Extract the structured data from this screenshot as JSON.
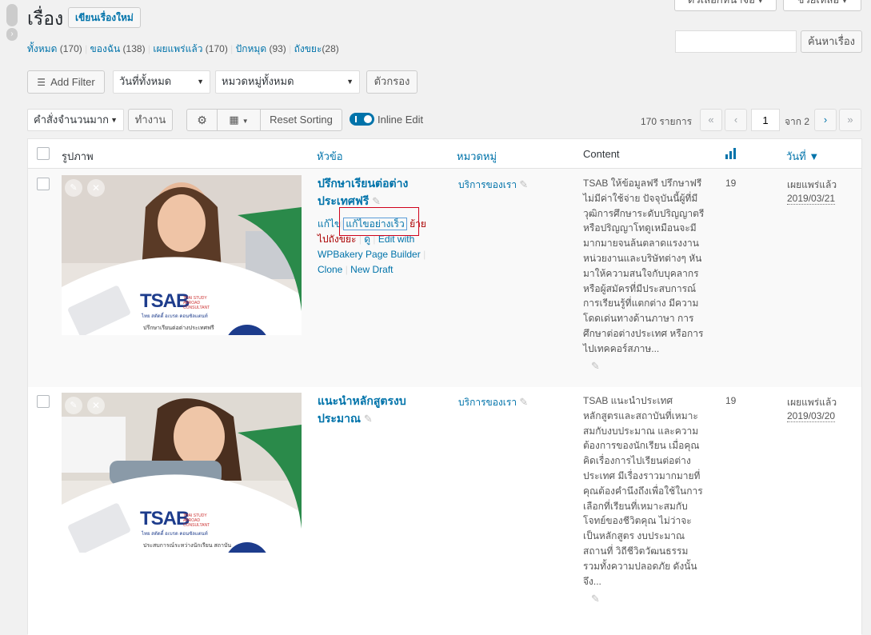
{
  "header": {
    "title": "เรื่อง",
    "add_new": "เขียนเรื่องใหม่",
    "screen_options": "ตัวเลือกหน้าจอ ▾",
    "help": "ช่วยเหลือ ▾"
  },
  "views": {
    "all": "ทั้งหมด",
    "all_count": "(170)",
    "mine": "ของฉัน",
    "mine_count": "(138)",
    "published": "เผยแพร่แล้ว",
    "published_count": "(170)",
    "sticky": "ปักหมุด",
    "sticky_count": "(93)",
    "trash": "ถังขยะ",
    "trash_count": "(28)"
  },
  "search": {
    "button": "ค้นหาเรื่อง",
    "value": ""
  },
  "filters": {
    "add_filter": "Add Filter",
    "date": "วันที่ทั้งหมด",
    "category": "หมวดหมู่ทั้งหมด",
    "filter_button": "ตัวกรอง"
  },
  "bulk": {
    "action": "คำสั่งจำนวนมาก",
    "apply": "ทำงาน",
    "reset_sorting": "Reset Sorting",
    "inline_edit": "Inline Edit"
  },
  "pagination": {
    "items": "170 รายการ",
    "first": "«",
    "prev": "‹",
    "current": "1",
    "of": "จาก 2",
    "next": "›",
    "last": "»"
  },
  "columns": {
    "image": "รูปภาพ",
    "title": "หัวข้อ",
    "category": "หมวดหมู่",
    "content": "Content",
    "date": "วันที่ ▼"
  },
  "rows": [
    {
      "title_line1": "ปรึกษาเรียนต่อต่าง",
      "title_line2": "ประเทศฟรี",
      "actions": {
        "edit": "แก้ไข",
        "quick_edit": "แก้ไขอย่างเร็ว",
        "trash_a": "ย้าย",
        "trash_b": "ไปถังขยะ",
        "view": "ดู",
        "wpbakery_a": "Edit with",
        "wpbakery_b": "WPBakery Page Builder",
        "clone": "Clone",
        "new_draft": "New Draft"
      },
      "category": "บริการของเรา",
      "content_lines": [
        "TSAB ให้ข้อมูลฟรี ปรึกษาฟรี",
        "ไม่มีค่าใช้จ่าย ปัจจุบันนี้ผู้ที่มี",
        "วุฒิการศึกษาระดับปริญญาตรี",
        "หรือปริญญาโทดูเหมือนจะมี",
        "มากมายจนล้นตลาดแรงงาน",
        "หน่วยงานและบริษัทต่างๆ หัน",
        "มาให้ความสนใจกับบุคลากร",
        "หรือผู้สมัครที่มีประสบการณ์",
        "การเรียนรู้ที่แตกต่าง มีความ",
        "โดดเด่นทางด้านภาษา การ",
        "ศึกษาต่อต่างประเทศ หรือการ",
        "ไปเทคคอร์สภาษ..."
      ],
      "views": "19",
      "status": "เผยแพร่แล้ว",
      "date": "2019/03/21",
      "thumb_line": "ปรึกษาเรียนต่อต่างประเทศฟรี"
    },
    {
      "title_line1": "แนะนำหลักสูตรงบ",
      "title_line2": "ประมาณ",
      "category": "บริการของเรา",
      "content_lines": [
        "TSAB แนะนำประเทศ",
        "หลักสูตรและสถาบันที่เหมาะ",
        "สมกับงบประมาณ และความ",
        "ต้องการของนักเรียน เมื่อคุณ",
        "คิดเรื่องการไปเรียนต่อต่าง",
        "ประเทศ มีเรื่องราวมากมายที่",
        "คุณต้องคำนึงถึงเพื่อใช้ในการ",
        "เลือกที่เรียนที่เหมาะสมกับ",
        "โจทย์ของชีวิตคุณ ไม่ว่าจะ",
        "เป็นหลักสูตร งบประมาณ",
        "สถานที่  วิถีชีวิตวัฒนธรรม",
        "รวมทั้งความปลอดภัย ดังนั้น",
        "จึง..."
      ],
      "views": "19",
      "status": "เผยแพร่แล้ว",
      "date": "2019/03/20",
      "thumb_line": "ประสบการณ์ระหว่างนักเรียน สถาบัน"
    }
  ],
  "brand": {
    "logo": "TSAB",
    "logo_sub1": "THAI STUDY",
    "logo_sub2": "ABROAD",
    "logo_sub3": "CONSULTANT",
    "logo_thai": "ไทย สตัดดี้ อเบรด คอนซัลแตนท์"
  },
  "colors": {
    "accent": "#0073aa",
    "trash": "#a00",
    "highlight": "#d0021b",
    "toggle": "#0073aa",
    "brand_green": "#2a8a4a",
    "brand_navy": "#1d3c8c"
  }
}
